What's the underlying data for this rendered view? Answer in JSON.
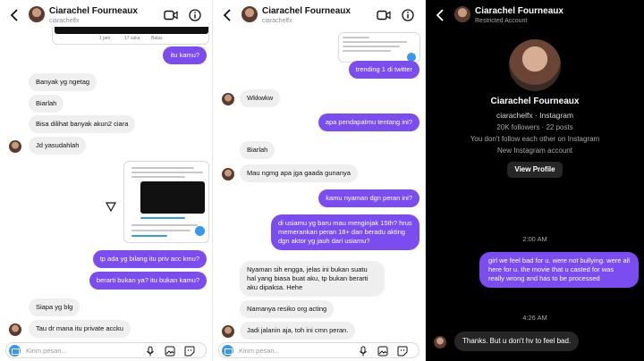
{
  "contact": {
    "name": "Ciarachel Fourneaux",
    "handle": "ciarachelfx"
  },
  "panel1": {
    "shared_post_footer": [
      "1 jam",
      "17 suka",
      "Balas"
    ],
    "messages": [
      {
        "dir": "out",
        "text": "itu kamu?"
      },
      {
        "dir": "in",
        "text": "Banyak yg ngetag"
      },
      {
        "dir": "in",
        "text": "Biarlah"
      },
      {
        "dir": "in",
        "text": "Bisa dilihat banyak akun2 ciara"
      },
      {
        "dir": "in",
        "text": "Jd yasudahlah"
      },
      {
        "dir": "out",
        "text": "tp ada yg bilang itu priv acc kmu?"
      },
      {
        "dir": "out",
        "text": "berarti bukan ya? itu bukan kamu?"
      },
      {
        "dir": "in",
        "text": "Siapa yg blg"
      },
      {
        "dir": "in",
        "text": "Tau dr mana itu private accku"
      }
    ]
  },
  "panel2": {
    "messages": [
      {
        "dir": "out",
        "text": "trending 1 di twitter"
      },
      {
        "dir": "in",
        "text": "Wkkwkw"
      },
      {
        "dir": "out",
        "text": "apa pendapatmu tentang ini?"
      },
      {
        "dir": "in",
        "text": "Biarlah"
      },
      {
        "dir": "in",
        "text": "Mau ngmg apa jga gaada gunanya"
      },
      {
        "dir": "out",
        "text": "kamu nyaman dgn peran ini?"
      },
      {
        "dir": "out",
        "text": "di usiamu yg baru mau menginjak 15th? hrus memerankan peran 18+ dan beradu akting dgn aktor yg jauh dari usiamu?"
      },
      {
        "dir": "in",
        "text": "Nyaman sih engga, jelas ini bukan suatu hal yang biasa buat aku, tp bukan berarti aku dipaksa. Hehe"
      },
      {
        "dir": "in",
        "text": "Namanya resiko org acting"
      },
      {
        "dir": "in",
        "text": "Jadi jalanin aja, toh ini cmn peran."
      }
    ]
  },
  "composer": {
    "placeholder": "Kirim pesan..."
  },
  "panel3": {
    "header_sub": "Restricted Account",
    "profile_handle_line": "ciarachelfx · Instagram",
    "stats": "20K followers · 22 posts",
    "follow_status": "You don't follow each other on Instagram",
    "account_note": "New Instagram account",
    "view_profile": "View Profile",
    "time1": "2:00 AM",
    "msg_out": "girl we feel bad for u. were not bullying. were all here for u. the movie that u casted for was really wrong and has to be processed",
    "time2": "4:26 AM",
    "msg_in": "Thanks. But u don't hv to feel bad."
  },
  "colors": {
    "accent": "#7b4cf0",
    "incoming": "#efefef",
    "dark_bg": "#000000",
    "dark_bubble": "#262626",
    "link": "#3897f0"
  }
}
